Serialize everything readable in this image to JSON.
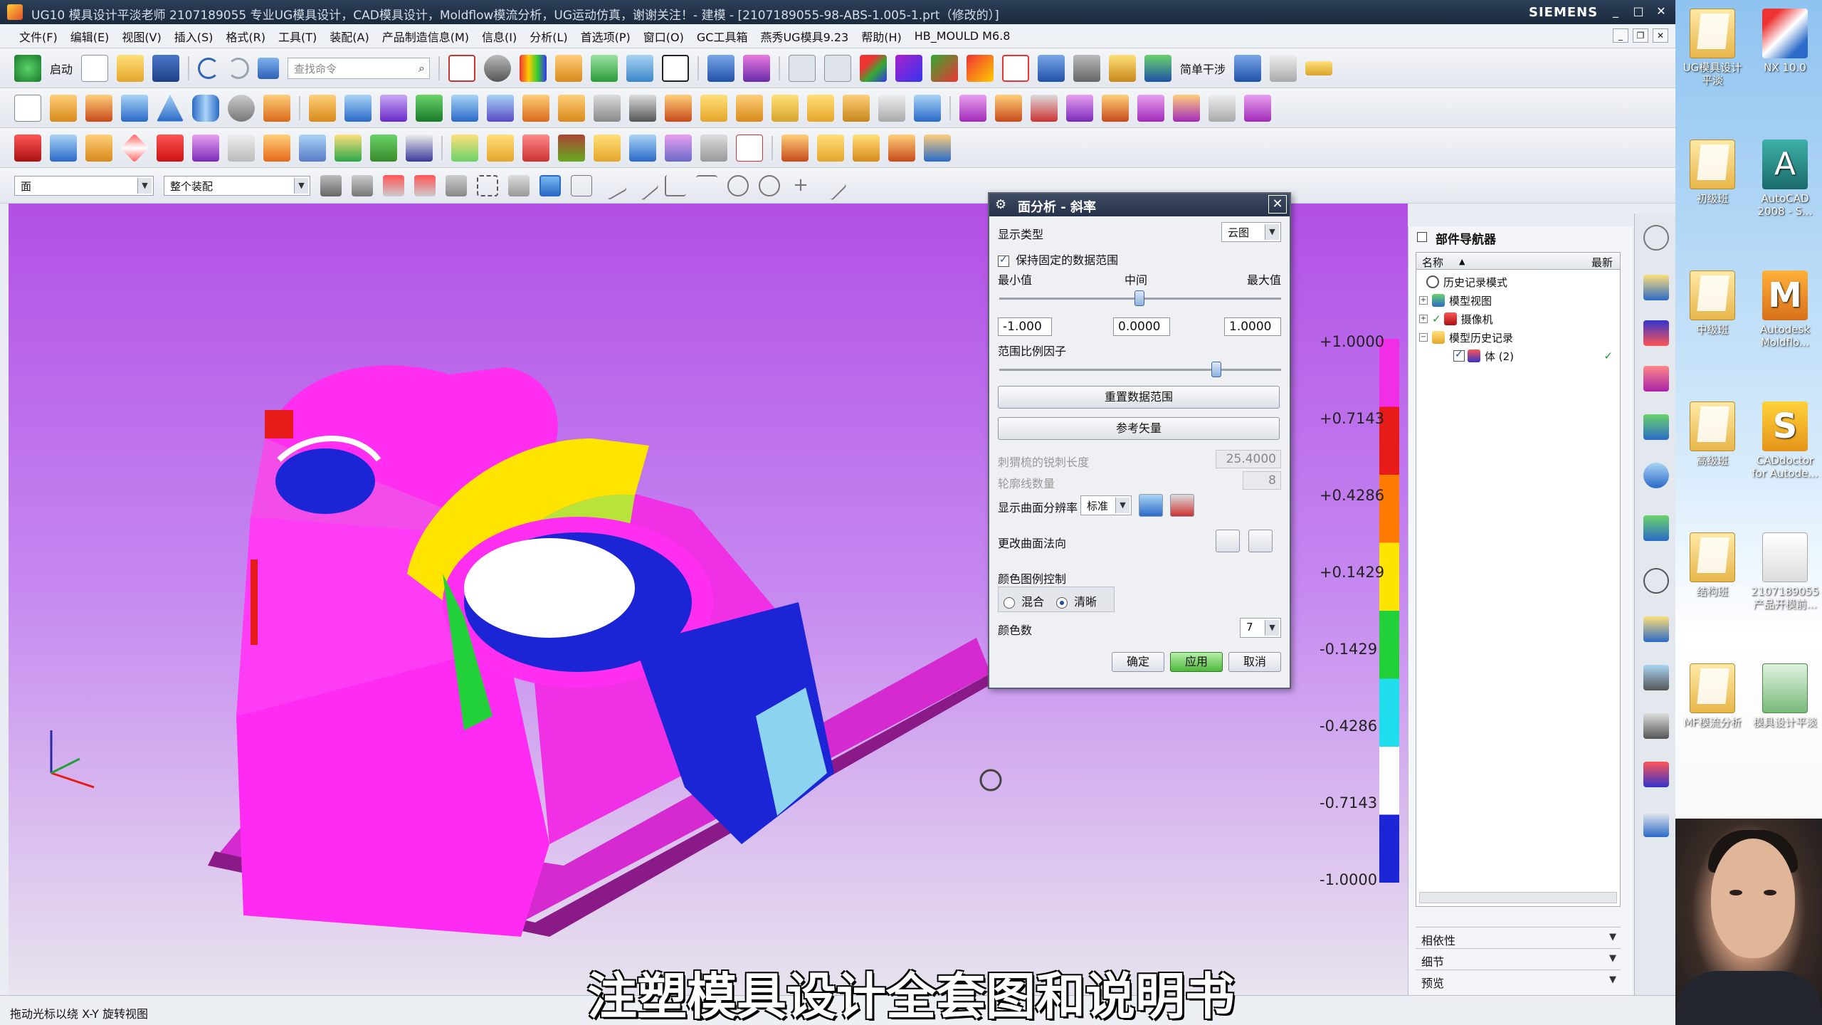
{
  "window": {
    "title": "UG10 模具设计平淡老师 2107189055 专业UG模具设计，CAD模具设计，Moldflow模流分析，UG运动仿真，谢谢关注！- 建模 - [2107189055-98-ABS-1.005-1.prt（修改的）]",
    "brand": "SIEMENS",
    "min": "_",
    "max": "□",
    "close": "✕"
  },
  "menu": {
    "items": [
      "文件(F)",
      "编辑(E)",
      "视图(V)",
      "插入(S)",
      "格式(R)",
      "工具(T)",
      "装配(A)",
      "产品制造信息(M)",
      "信息(I)",
      "分析(L)",
      "首选项(P)",
      "窗口(O)",
      "GC工具箱",
      "燕秀UG模具9.23",
      "帮助(H)",
      "HB_MOULD M6.8"
    ]
  },
  "toolbar": {
    "start": "启动",
    "search_placeholder": "查找命令",
    "simple_interference": "简单干涉",
    "filter_value": "面",
    "assembly_value": "整个装配"
  },
  "dialog": {
    "title": "面分析 - 斜率",
    "display_type_label": "显示类型",
    "display_type_value": "云图",
    "keep_range": "保持固定的数据范围",
    "min_label": "最小值",
    "mid_label": "中间",
    "max_label": "最大值",
    "min_value": "-1.000",
    "mid_value": "0.0000",
    "max_value": "1.0000",
    "range_scale": "范围比例因子",
    "reset_range": "重置数据范围",
    "ref_vector": "参考矢量",
    "spike_length_label": "刺猬梳的锐刺长度",
    "spike_length_value": "25.4000",
    "contour_count_label": "轮廓线数量",
    "contour_count_value": "8",
    "resolution_label": "显示曲面分辨率",
    "resolution_value": "标准",
    "normal_label": "更改曲面法向",
    "color_ctrl_label": "颜色图例控制",
    "blend": "混合",
    "sharp": "清晰",
    "color_count_label": "颜色数",
    "color_count_value": "7",
    "ok": "确定",
    "apply": "应用",
    "cancel": "取消"
  },
  "scale": {
    "labels": [
      "+1.0000",
      "+0.7143",
      "+0.4286",
      "+0.1429",
      "-0.1429",
      "-0.4286",
      "-0.7143",
      "-1.0000"
    ],
    "colors": [
      "#f02ee6",
      "#e81b1b",
      "#ff7a00",
      "#ffe400",
      "#22d03a",
      "#20ddee",
      "#ffffff",
      "#1b25d6"
    ]
  },
  "navigator": {
    "title": "部件导航器",
    "col_name": "名称",
    "col_latest": "最新",
    "items": [
      {
        "label": "历史记录模式",
        "indent": 0
      },
      {
        "label": "模型视图",
        "indent": 0
      },
      {
        "label": "摄像机",
        "indent": 0
      },
      {
        "label": "模型历史记录",
        "indent": 0
      },
      {
        "label": "体 (2)",
        "indent": 1
      }
    ],
    "sections": [
      "相依性",
      "细节",
      "预览"
    ]
  },
  "desktop": {
    "icons": [
      "UG模具设计平淡",
      "NX 10.0",
      "初级班",
      "AutoCAD 2008 - S...",
      "中级班",
      "Autodesk Moldflo...",
      "高级班",
      "CADdoctor for Autode...",
      "结构班",
      "2107189055 产品开模前...",
      "MF模流分析",
      "模具设计平淡"
    ]
  },
  "status": {
    "message": "拖动光标以绕 X-Y 旋转视图"
  },
  "subtitle": "注塑模具设计全套图和说明书"
}
